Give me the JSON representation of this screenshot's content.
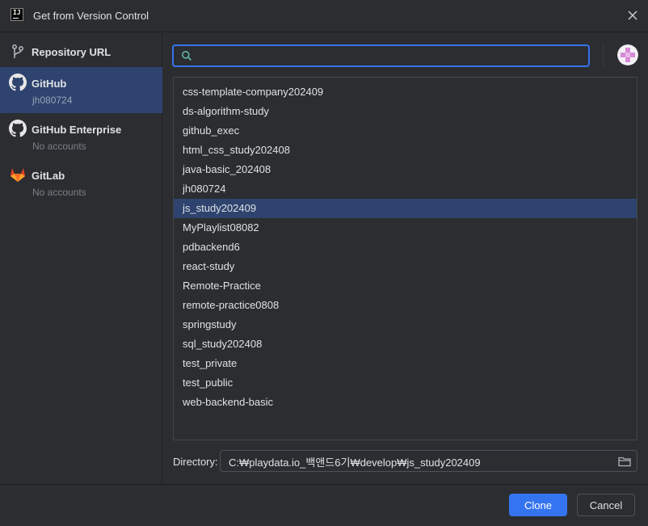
{
  "window": {
    "title": "Get from Version Control"
  },
  "sidebar": {
    "items": [
      {
        "label": "Repository URL",
        "sub": ""
      },
      {
        "label": "GitHub",
        "sub": "jh080724"
      },
      {
        "label": "GitHub Enterprise",
        "sub": "No accounts"
      },
      {
        "label": "GitLab",
        "sub": "No accounts"
      }
    ],
    "selected_index": 1
  },
  "search": {
    "value": "",
    "placeholder": ""
  },
  "repositories": [
    "css-template-company202409",
    "ds-algorithm-study",
    "github_exec",
    "html_css_study202408",
    "java-basic_202408",
    "jh080724",
    "js_study202409",
    "MyPlaylist08082",
    "pdbackend6",
    "react-study",
    "Remote-Practice",
    "remote-practice0808",
    "springstudy",
    "sql_study202408",
    "test_private",
    "test_public",
    "web-backend-basic"
  ],
  "selected_repository": "js_study202409",
  "directory": {
    "label": "Directory:",
    "value": "C:₩playdata.io_백앤드6기₩develop₩js_study202409"
  },
  "buttons": {
    "clone": "Clone",
    "cancel": "Cancel"
  },
  "icons": {
    "app": "intellij-logo-icon",
    "close": "close-icon",
    "repo_url": "git-branch-icon",
    "github": "github-icon",
    "github_enterprise": "github-icon",
    "gitlab": "gitlab-icon",
    "search": "search-icon",
    "folder": "folder-icon"
  },
  "colors": {
    "accent": "#3574f0",
    "selection": "#2e436e",
    "background": "#2b2d30",
    "gitlab_orange": "#e24329"
  }
}
